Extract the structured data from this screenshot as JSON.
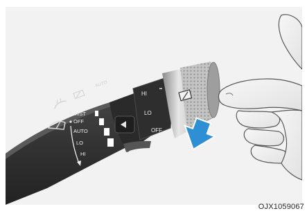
{
  "figure": {
    "code": "OJX1059067",
    "stalk_labels": {
      "mist": "MIST",
      "off": "OFF",
      "auto": "AUTO",
      "lo": "LO",
      "hi": "HI",
      "auto_top": "AUTO"
    },
    "knob_labels": {
      "hi": "HI",
      "lo": "LO",
      "off": "OFF"
    },
    "icons": [
      "front-wiper-icon",
      "rear-wiper-icon",
      "washer-icon",
      "press-arrow-icon",
      "hand-icon"
    ],
    "colors": {
      "background": "#f2f2f2",
      "stalk": "#3a3a3a",
      "knob_chrome": "#c9c9c9",
      "arrow": "#2e8fd4"
    }
  }
}
